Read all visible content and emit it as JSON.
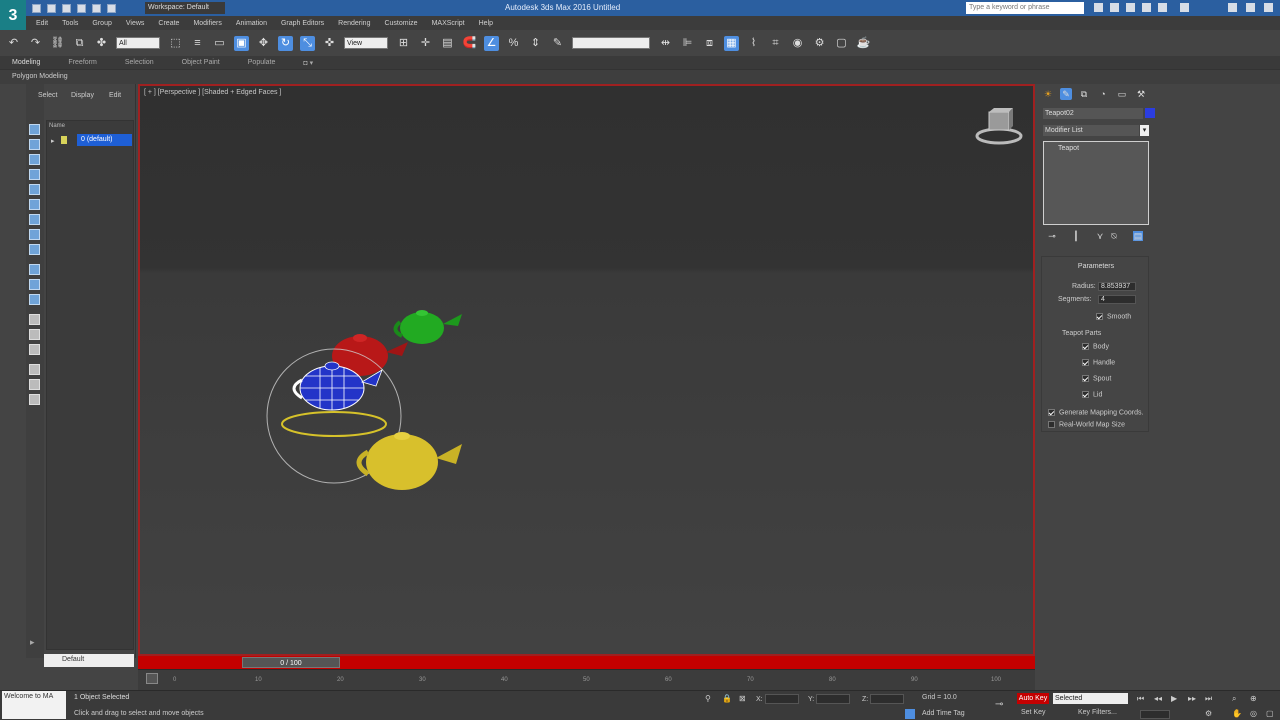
{
  "titlebar": {
    "app_logo": "3",
    "workspace": "Workspace: Default",
    "title": "Autodesk 3ds Max 2016  Untitled",
    "search_placeholder": "Type a keyword or phrase"
  },
  "menu": [
    "Edit",
    "Tools",
    "Group",
    "Views",
    "Create",
    "Modifiers",
    "Animation",
    "Graph Editors",
    "Rendering",
    "Customize",
    "MAXScript",
    "Help"
  ],
  "toolbar": {
    "selection_filter": "All",
    "ref_coord": "View",
    "named_selection": ""
  },
  "ribbon": {
    "tabs": [
      "Modeling",
      "Freeform",
      "Selection",
      "Object Paint",
      "Populate"
    ],
    "sub_label": "Polygon Modeling"
  },
  "scene_explorer": {
    "menus": [
      "Select",
      "Display",
      "Edit"
    ],
    "column_header": "Name",
    "layer": "0 (default)",
    "filter_value": "Default"
  },
  "viewport": {
    "label": "[ + ] [Perspective ] [Shaded + Edged Faces ]"
  },
  "timeline": {
    "slider_label": "0 / 100",
    "ticks": [
      "0",
      "10",
      "20",
      "30",
      "40",
      "50",
      "60",
      "70",
      "80",
      "90",
      "100"
    ]
  },
  "status": {
    "maxscript": "Welcome to MA",
    "selected": "1 Object Selected",
    "prompt": "Click and drag to select and move objects",
    "x_label": "X:",
    "y_label": "Y:",
    "z_label": "Z:",
    "x_value": "",
    "y_value": "",
    "z_value": "",
    "grid": "Grid = 10.0",
    "add_time_tag": "Add Time Tag",
    "autokey": "Auto Key",
    "selected_dd": "Selected",
    "set_key": "Set Key",
    "key_filters": "Key Filters..."
  },
  "command_panel": {
    "object_name": "Teapot02",
    "modifier_list": "Modifier List",
    "stack_item": "Teapot",
    "rollout_title": "Parameters",
    "radius_label": "Radius:",
    "radius_value": "8.853937",
    "segments_label": "Segments:",
    "segments_value": "4",
    "smooth_label": "Smooth",
    "teapot_parts_label": "Teapot Parts",
    "body_label": "Body",
    "handle_label": "Handle",
    "spout_label": "Spout",
    "lid_label": "Lid",
    "gen_mapping_label": "Generate Mapping Coords.",
    "real_world_label": "Real-World Map Size",
    "swatch_color": "#2b3de0"
  },
  "colors": {
    "active_viewport_border": "#a02020",
    "accent_blue": "#4e8ee0",
    "timebar_red": "#c40000"
  }
}
